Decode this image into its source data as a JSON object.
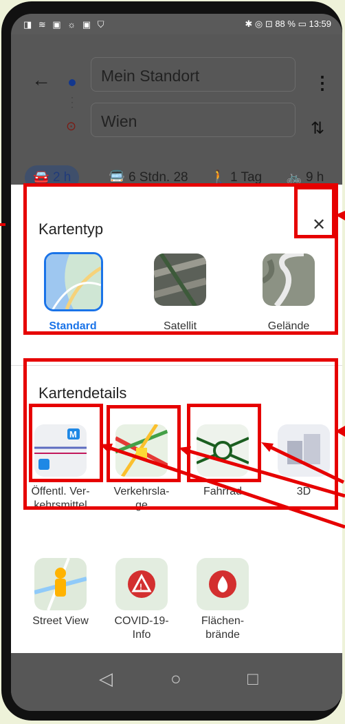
{
  "status_bar": {
    "left_icons": "◨ ≋ ▣ ☼ ▣ ⛉",
    "right_text": "✱ ◎ ⊡ 88 % ▭ 13:59"
  },
  "directions": {
    "origin": "Mein Standort",
    "destination": "Wien",
    "modes": [
      {
        "icon": "car-icon",
        "label": "2 h"
      },
      {
        "icon": "transit-icon",
        "label": "6 Stdn. 28"
      },
      {
        "icon": "walk-icon",
        "label": "1 Tag"
      },
      {
        "icon": "bike-icon",
        "label": "9 h"
      }
    ]
  },
  "map_type": {
    "title": "Kartentyp",
    "close_label": "✕",
    "options": [
      {
        "label": "Standard",
        "selected": true
      },
      {
        "label": "Satellit",
        "selected": false
      },
      {
        "label": "Gelände",
        "selected": false
      }
    ]
  },
  "map_details": {
    "title": "Kartendetails",
    "row1": [
      {
        "label": "Öffentl. Ver-\nkehrsmittel"
      },
      {
        "label": "Verkehrsla-\nge"
      },
      {
        "label": "Fahrrad"
      },
      {
        "label": "3D"
      }
    ],
    "row2": [
      {
        "label": "Street View"
      },
      {
        "label": "COVID-19-\nInfo"
      },
      {
        "label": "Flächen-\nbrände"
      }
    ]
  },
  "colors": {
    "annotation_red": "#e60000",
    "selected_blue": "#1a73e8"
  }
}
